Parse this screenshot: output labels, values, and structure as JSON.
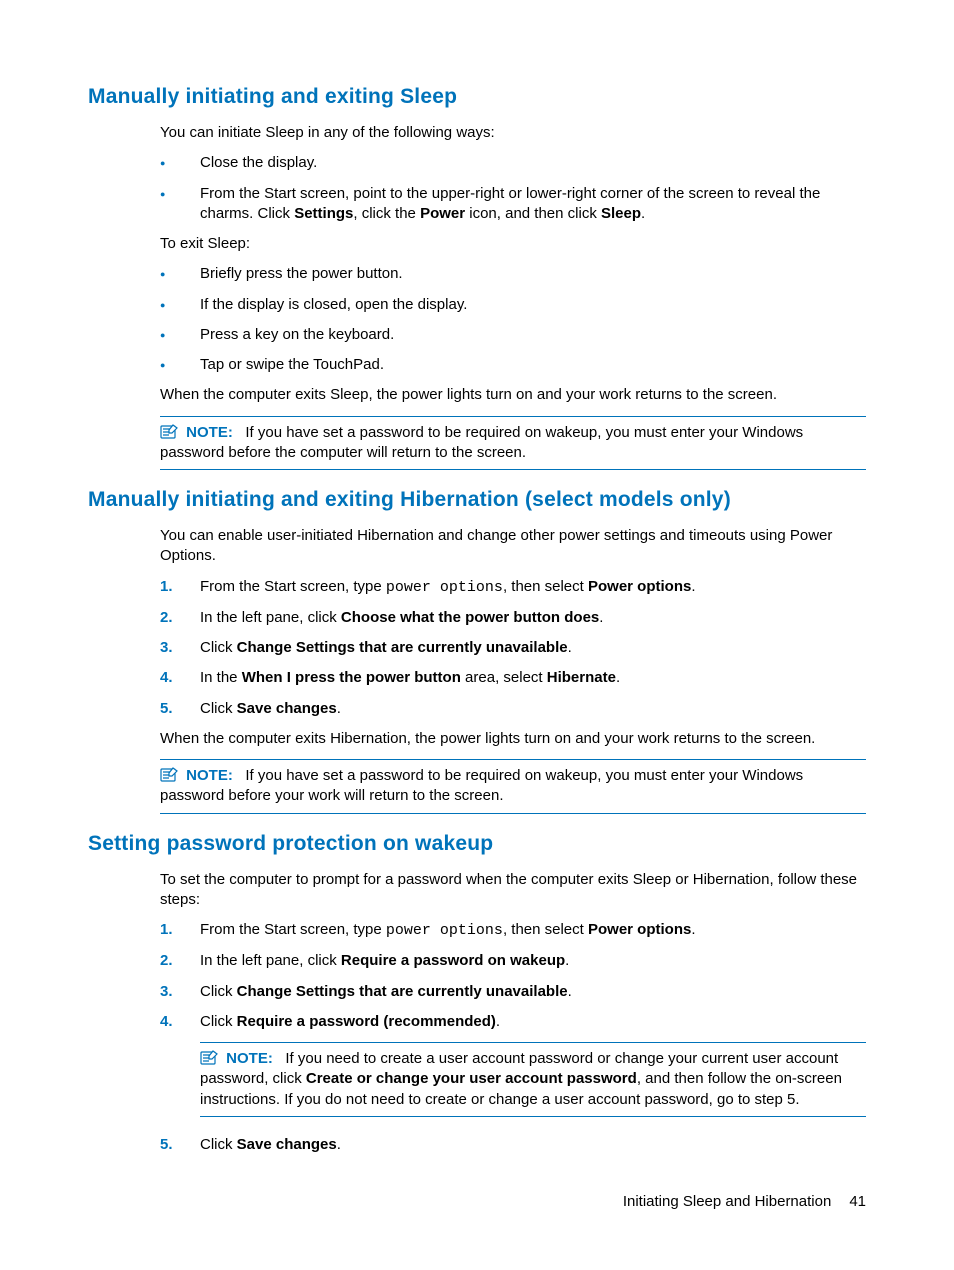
{
  "section1": {
    "heading": "Manually initiating and exiting Sleep",
    "intro": "You can initiate Sleep in any of the following ways:",
    "bullets_a": [
      "Close the display.",
      {
        "pre": "From the Start screen, point to the upper-right or lower-right corner of the screen to reveal the charms. Click ",
        "b1": "Settings",
        "mid1": ", click the ",
        "b2": "Power",
        "mid2": " icon, and then click ",
        "b3": "Sleep",
        "post": "."
      }
    ],
    "exit_label": "To exit Sleep:",
    "bullets_b": [
      "Briefly press the power button.",
      "If the display is closed, open the display.",
      "Press a key on the keyboard.",
      "Tap or swipe the TouchPad."
    ],
    "after": "When the computer exits Sleep, the power lights turn on and your work returns to the screen.",
    "note_label": "NOTE:",
    "note_text": "If you have set a password to be required on wakeup, you must enter your Windows password before the computer will return to the screen."
  },
  "section2": {
    "heading": "Manually initiating and exiting Hibernation (select models only)",
    "intro": "You can enable user-initiated Hibernation and change other power settings and timeouts using Power Options.",
    "steps": [
      {
        "pre": "From the Start screen, type ",
        "mono": "power options",
        "mid": ", then select ",
        "b": "Power options",
        "post": "."
      },
      {
        "pre": "In the left pane, click ",
        "b": "Choose what the power button does",
        "post": "."
      },
      {
        "pre": "Click ",
        "b": "Change Settings that are currently unavailable",
        "post": "."
      },
      {
        "pre": "In the ",
        "b": "When I press the power button",
        "mid": " area, select ",
        "b2": "Hibernate",
        "post": "."
      },
      {
        "pre": "Click ",
        "b": "Save changes",
        "post": "."
      }
    ],
    "after": "When the computer exits Hibernation, the power lights turn on and your work returns to the screen.",
    "note_label": "NOTE:",
    "note_text": "If you have set a password to be required on wakeup, you must enter your Windows password before your work will return to the screen."
  },
  "section3": {
    "heading": "Setting password protection on wakeup",
    "intro": "To set the computer to prompt for a password when the computer exits Sleep or Hibernation, follow these steps:",
    "steps_a": [
      {
        "pre": "From the Start screen, type ",
        "mono": "power options",
        "mid": ", then select ",
        "b": "Power options",
        "post": "."
      },
      {
        "pre": "In the left pane, click ",
        "b": "Require a password on wakeup",
        "post": "."
      },
      {
        "pre": "Click ",
        "b": "Change Settings that are currently unavailable",
        "post": "."
      },
      {
        "pre": "Click ",
        "b": "Require a password (recommended)",
        "post": "."
      }
    ],
    "note_label": "NOTE:",
    "note_pre": "If you need to create a user account password or change your current user account password, click ",
    "note_b": "Create or change your user account password",
    "note_post": ", and then follow the on-screen instructions. If you do not need to create or change a user account password, go to step 5.",
    "steps_b": [
      {
        "pre": "Click ",
        "b": "Save changes",
        "post": "."
      }
    ]
  },
  "footer": {
    "title": "Initiating Sleep and Hibernation",
    "page": "41"
  }
}
